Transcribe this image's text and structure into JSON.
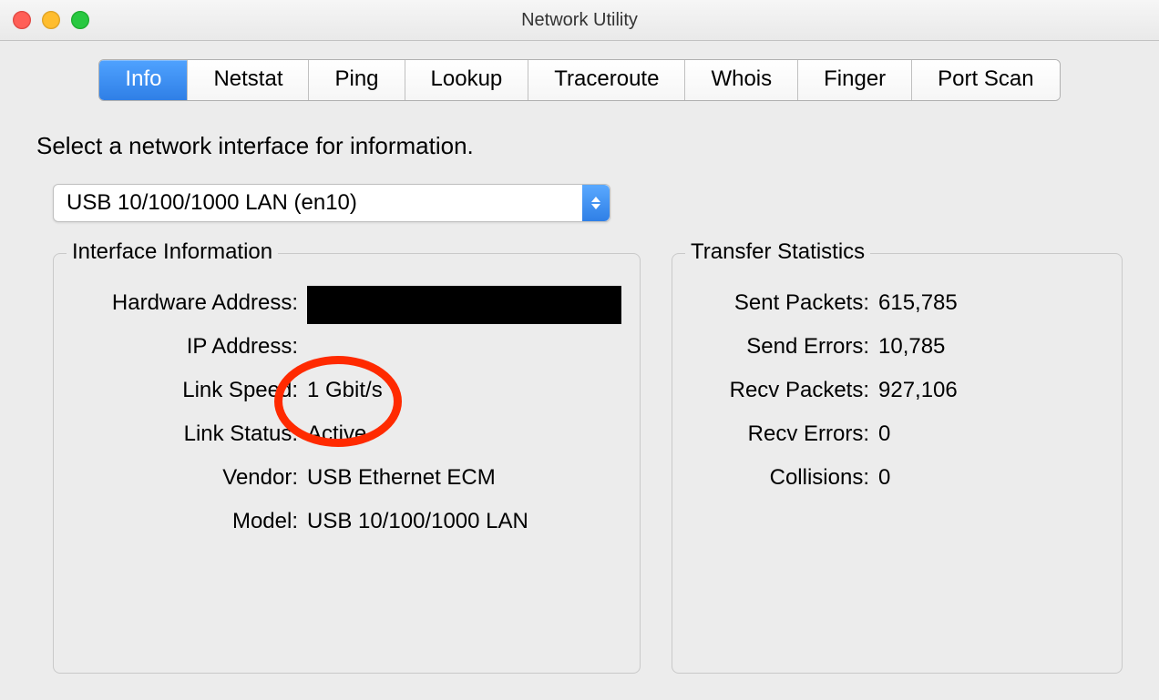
{
  "window": {
    "title": "Network Utility"
  },
  "tabs": [
    {
      "label": "Info",
      "active": true
    },
    {
      "label": "Netstat",
      "active": false
    },
    {
      "label": "Ping",
      "active": false
    },
    {
      "label": "Lookup",
      "active": false
    },
    {
      "label": "Traceroute",
      "active": false
    },
    {
      "label": "Whois",
      "active": false
    },
    {
      "label": "Finger",
      "active": false
    },
    {
      "label": "Port Scan",
      "active": false
    }
  ],
  "prompt": "Select a network interface for information.",
  "interface_select": {
    "selected": "USB 10/100/1000 LAN (en10)"
  },
  "interface_info": {
    "panel_title": "Interface Information",
    "labels": {
      "hardware_address": "Hardware Address:",
      "ip_address": "IP Address:",
      "link_speed": "Link Speed:",
      "link_status": "Link Status:",
      "vendor": "Vendor:",
      "model": "Model:"
    },
    "values": {
      "hardware_address": "",
      "ip_address": "",
      "link_speed": "1 Gbit/s",
      "link_status": "Active",
      "vendor": "USB Ethernet ECM",
      "model": "USB 10/100/1000 LAN"
    }
  },
  "transfer_stats": {
    "panel_title": "Transfer Statistics",
    "labels": {
      "sent_packets": "Sent Packets:",
      "send_errors": "Send Errors:",
      "recv_packets": "Recv Packets:",
      "recv_errors": "Recv Errors:",
      "collisions": "Collisions:"
    },
    "values": {
      "sent_packets": "615,785",
      "send_errors": "10,785",
      "recv_packets": "927,106",
      "recv_errors": "0",
      "collisions": "0"
    }
  }
}
